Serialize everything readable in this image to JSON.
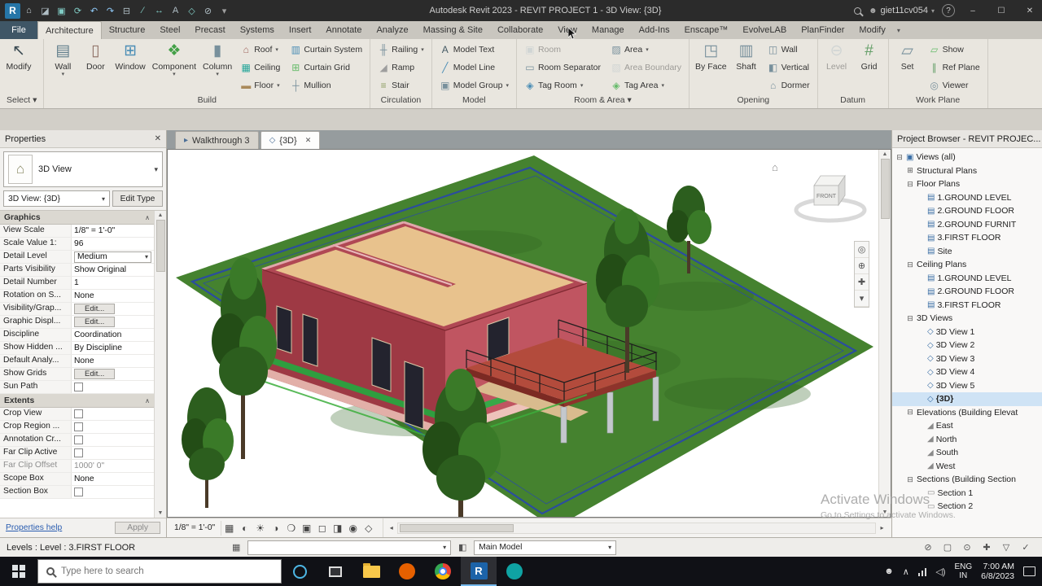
{
  "ui": {
    "caret": "▾",
    "close": "✕",
    "chevron_up": "∧",
    "up": "▲",
    "down": "▼",
    "left": "◂",
    "right": "▸",
    "minus": "⊟",
    "plus": "⊞",
    "home": "⌂",
    "thumb_glyph": "⌂"
  },
  "titlebar": {
    "title": "Autodesk Revit 2023 - REVIT PROJECT 1 - 3D View: {3D}",
    "user": "giet11cv054",
    "help_label": "?",
    "person_glyph": "☻",
    "window_controls": {
      "minimize": "–",
      "maximize": "☐",
      "close": "✕"
    },
    "qat_icons": [
      {
        "name": "revit-app-icon",
        "glyph": "R",
        "cls": "rlogo"
      },
      {
        "name": "home-icon",
        "glyph": "⌂",
        "c": "#cfd8dc"
      },
      {
        "name": "open-folder-icon",
        "glyph": "◪",
        "c": "#b0bec5"
      },
      {
        "name": "save-icon",
        "glyph": "▣",
        "c": "#80cbc4"
      },
      {
        "name": "sync-icon",
        "glyph": "⟳",
        "c": "#80cbc4"
      },
      {
        "name": "undo-icon",
        "glyph": "↶",
        "c": "#90caf9"
      },
      {
        "name": "redo-icon",
        "glyph": "↷",
        "c": "#90caf9"
      },
      {
        "name": "print-icon",
        "glyph": "⊟",
        "c": "#b0bec5"
      },
      {
        "name": "measure-icon",
        "glyph": "∕",
        "c": "#80cbc4"
      },
      {
        "name": "dimension-icon",
        "glyph": "↔",
        "c": "#80cbc4"
      },
      {
        "name": "text-icon",
        "glyph": "A",
        "c": "#b0bec5"
      },
      {
        "name": "3d-view-icon",
        "glyph": "◇",
        "c": "#80cbc4"
      },
      {
        "name": "section-icon",
        "glyph": "⊘",
        "c": "#b0bec5"
      },
      {
        "name": "qat-caret-icon",
        "glyph": "▾",
        "c": "#9e9e9e"
      }
    ]
  },
  "ribbon": {
    "file_tab": "File",
    "tabs_caret": "▾",
    "tabs": [
      {
        "label": "Architecture",
        "active": true
      },
      {
        "label": "Structure"
      },
      {
        "label": "Steel"
      },
      {
        "label": "Precast"
      },
      {
        "label": "Systems"
      },
      {
        "label": "Insert"
      },
      {
        "label": "Annotate"
      },
      {
        "label": "Analyze"
      },
      {
        "label": "Massing & Site"
      },
      {
        "label": "Collaborate"
      },
      {
        "label": "View"
      },
      {
        "label": "Manage"
      },
      {
        "label": "Add-Ins"
      },
      {
        "label": "Enscape™"
      },
      {
        "label": "EvolveLAB"
      },
      {
        "label": "PlanFinder"
      },
      {
        "label": "Modify"
      }
    ],
    "icon_map": {
      "modify-cursor": {
        "g": "↖",
        "c": "#37474f"
      },
      "wall": {
        "g": "▤",
        "c": "#607d8b"
      },
      "door": {
        "g": "▯",
        "c": "#8d6e63"
      },
      "window": {
        "g": "⊞",
        "c": "#4a8db5"
      },
      "component": {
        "g": "❖",
        "c": "#43a047"
      },
      "column": {
        "g": "▮",
        "c": "#78909c"
      },
      "roof": {
        "g": "⌂",
        "c": "#a1665e"
      },
      "ceiling": {
        "g": "▦",
        "c": "#26a69a"
      },
      "floor": {
        "g": "▬",
        "c": "#a98a5b"
      },
      "curtain-system": {
        "g": "▥",
        "c": "#4a8db5"
      },
      "curtain-grid": {
        "g": "⊞",
        "c": "#66bb6a"
      },
      "mullion": {
        "g": "┼",
        "c": "#78909c"
      },
      "railing": {
        "g": "╫",
        "c": "#78909c"
      },
      "ramp": {
        "g": "◢",
        "c": "#9e9e9e"
      },
      "stair": {
        "g": "≡",
        "c": "#8d9e63"
      },
      "model-text": {
        "g": "A",
        "c": "#455a64"
      },
      "model-line": {
        "g": "╱",
        "c": "#4a8db5"
      },
      "model-group": {
        "g": "▣",
        "c": "#78909c"
      },
      "room": {
        "g": "▣",
        "c": "#b0bec5"
      },
      "room-separator": {
        "g": "▭",
        "c": "#78909c"
      },
      "tag-room": {
        "g": "◈",
        "c": "#4a8db5"
      },
      "area": {
        "g": "▨",
        "c": "#78909c"
      },
      "area-boundary": {
        "g": "▧",
        "c": "#b0bec5"
      },
      "tag-area": {
        "g": "◈",
        "c": "#66bb6a"
      },
      "by-face": {
        "g": "◳",
        "c": "#78909c"
      },
      "shaft": {
        "g": "▥",
        "c": "#78909c"
      },
      "wall-opening": {
        "g": "◫",
        "c": "#78909c"
      },
      "vertical-opening": {
        "g": "◧",
        "c": "#78909c"
      },
      "dormer": {
        "g": "⌂",
        "c": "#78909c"
      },
      "level": {
        "g": "⊖",
        "c": "#b0bec5"
      },
      "grid": {
        "g": "#",
        "c": "#66a06a"
      },
      "set-plane": {
        "g": "▱",
        "c": "#78909c"
      },
      "show-plane": {
        "g": "▱",
        "c": "#66bb6a"
      },
      "ref-plane": {
        "g": "∥",
        "c": "#66a06a"
      },
      "viewer": {
        "g": "◎",
        "c": "#78909c"
      }
    },
    "panels": [
      {
        "name": "Select ▾",
        "big": [
          {
            "label": "Modify",
            "icon": "modify-cursor"
          }
        ]
      },
      {
        "name": "Build",
        "big": [
          {
            "label": "Wall",
            "icon": "wall",
            "arrow": true
          },
          {
            "label": "Door",
            "icon": "door"
          },
          {
            "label": "Window",
            "icon": "window"
          },
          {
            "label": "Component",
            "icon": "component",
            "arrow": true
          },
          {
            "label": "Column",
            "icon": "column",
            "arrow": true
          }
        ],
        "cols": [
          [
            {
              "label": "Roof",
              "icon": "roof",
              "arrow": true
            },
            {
              "label": "Ceiling",
              "icon": "ceiling"
            },
            {
              "label": "Floor",
              "icon": "floor",
              "arrow": true
            }
          ],
          [
            {
              "label": "Curtain System",
              "icon": "curtain-system"
            },
            {
              "label": "Curtain Grid",
              "icon": "curtain-grid"
            },
            {
              "label": "Mullion",
              "icon": "mullion"
            }
          ]
        ]
      },
      {
        "name": "Circulation",
        "cols": [
          [
            {
              "label": "Railing",
              "icon": "railing",
              "arrow": true
            },
            {
              "label": "Ramp",
              "icon": "ramp"
            },
            {
              "label": "Stair",
              "icon": "stair"
            }
          ]
        ]
      },
      {
        "name": "Model",
        "cols": [
          [
            {
              "label": "Model Text",
              "icon": "model-text"
            },
            {
              "label": "Model Line",
              "icon": "model-line"
            },
            {
              "label": "Model Group",
              "icon": "model-group",
              "arrow": true
            }
          ]
        ]
      },
      {
        "name": "Room & Area ▾",
        "cols": [
          [
            {
              "label": "Room",
              "icon": "room",
              "disabled": true
            },
            {
              "label": "Room Separator",
              "icon": "room-separator"
            },
            {
              "label": "Tag Room",
              "icon": "tag-room",
              "arrow": true
            }
          ],
          [
            {
              "label": "Area",
              "icon": "area",
              "arrow": true
            },
            {
              "label": "Area Boundary",
              "icon": "area-boundary",
              "disabled": true
            },
            {
              "label": "Tag Area",
              "icon": "tag-area",
              "arrow": true
            }
          ]
        ]
      },
      {
        "name": "Opening",
        "big": [
          {
            "label": "By Face",
            "icon": "by-face"
          },
          {
            "label": "Shaft",
            "icon": "shaft"
          }
        ],
        "cols": [
          [
            {
              "label": "Wall",
              "icon": "wall-opening"
            },
            {
              "label": "Vertical",
              "icon": "vertical-opening"
            },
            {
              "label": "Dormer",
              "icon": "dormer"
            }
          ]
        ]
      },
      {
        "name": "Datum",
        "big": [
          {
            "label": "Level",
            "icon": "level",
            "disabled": true
          },
          {
            "label": "Grid",
            "icon": "grid"
          }
        ]
      },
      {
        "name": "Work Plane",
        "big": [
          {
            "label": "Set",
            "icon": "set-plane"
          }
        ],
        "cols": [
          [
            {
              "label": "Show",
              "icon": "show-plane"
            },
            {
              "label": "Ref Plane",
              "icon": "ref-plane"
            },
            {
              "label": "Viewer",
              "icon": "viewer"
            }
          ]
        ]
      }
    ]
  },
  "properties": {
    "panel_title": "Properties",
    "type_label": "3D View",
    "instance_combo": "3D View: {3D}",
    "edit_type_label": "Edit Type",
    "graphics_header": "Graphics",
    "extents_header": "Extents",
    "graphics_rows": [
      {
        "label": "View Scale",
        "value": "1/8\" = 1'-0\""
      },
      {
        "label": "Scale Value    1:",
        "value": "96"
      },
      {
        "label": "Detail Level",
        "value": "Medium",
        "type": "select"
      },
      {
        "label": "Parts Visibility",
        "value": "Show Original"
      },
      {
        "label": "Detail Number",
        "value": "1"
      },
      {
        "label": "Rotation on S...",
        "value": "None"
      },
      {
        "label": "Visibility/Grap...",
        "value": "Edit...",
        "type": "button"
      },
      {
        "label": "Graphic Displ...",
        "value": "Edit...",
        "type": "button"
      },
      {
        "label": "Discipline",
        "value": "Coordination"
      },
      {
        "label": "Show Hidden ...",
        "value": "By Discipline"
      },
      {
        "label": "Default Analy...",
        "value": "None"
      },
      {
        "label": "Show Grids",
        "value": "Edit...",
        "type": "button"
      },
      {
        "label": "Sun Path",
        "type": "check"
      }
    ],
    "extents_rows": [
      {
        "label": "Crop View",
        "type": "check"
      },
      {
        "label": "Crop Region ...",
        "type": "check"
      },
      {
        "label": "Annotation Cr...",
        "type": "check"
      },
      {
        "label": "Far Clip Active",
        "type": "check"
      },
      {
        "label": "Far Clip Offset",
        "value": "1000' 0\"",
        "dim": true
      },
      {
        "label": "Scope Box",
        "value": "None"
      },
      {
        "label": "Section Box",
        "type": "check"
      }
    ],
    "help_link": "Properties help",
    "apply_label": "Apply"
  },
  "view_tabs": [
    {
      "label": "Walkthrough 3",
      "icon": "walkthrough-tab-icon",
      "glyph": "▸"
    },
    {
      "label": "{3D}",
      "icon": "3d-view-tab-icon",
      "glyph": "◇",
      "active": true
    }
  ],
  "canvas": {
    "viewcube_front": "FRONT"
  },
  "navbar_icons": [
    {
      "name": "navigation-wheel-icon",
      "glyph": "◎"
    },
    {
      "name": "zoom-icon",
      "glyph": "⊕"
    },
    {
      "name": "pan-icon",
      "glyph": "✚"
    },
    {
      "name": "navbar-caret-icon",
      "glyph": "▾"
    }
  ],
  "viewbar": {
    "scale": "1/8\" = 1'-0\"",
    "icons": [
      {
        "name": "detail-level-icon",
        "glyph": "▦"
      },
      {
        "name": "visual-style-icon",
        "glyph": "◐"
      },
      {
        "name": "sun-path-icon",
        "glyph": "☀"
      },
      {
        "name": "shadows-icon",
        "glyph": "◑"
      },
      {
        "name": "render-icon",
        "glyph": "❍"
      },
      {
        "name": "crop-view-icon",
        "glyph": "▣"
      },
      {
        "name": "crop-region-icon",
        "glyph": "◻"
      },
      {
        "name": "hide-isolate-icon",
        "glyph": "◨"
      },
      {
        "name": "reveal-hidden-icon",
        "glyph": "◉"
      },
      {
        "name": "view-properties-icon",
        "glyph": "◇"
      }
    ]
  },
  "project_browser": {
    "panel_title": "Project Browser - REVIT PROJEC...",
    "icon_map": {
      "views-root": "▣",
      "plan": "▤",
      "view3d": "◇",
      "elevation": "◢",
      "section": "▭"
    },
    "tree": [
      {
        "t": "Views (all)",
        "d": 0,
        "e": 1,
        "icon": "views-root"
      },
      {
        "t": "Structural Plans",
        "d": 1,
        "e": 0
      },
      {
        "t": "Floor Plans",
        "d": 1,
        "e": 1
      },
      {
        "t": "1.GROUND LEVEL",
        "d": 2,
        "icon": "plan"
      },
      {
        "t": "2.GROUND FLOOR",
        "d": 2,
        "icon": "plan"
      },
      {
        "t": "2.GROUND FURNIT",
        "d": 2,
        "icon": "plan"
      },
      {
        "t": "3.FIRST FLOOR",
        "d": 2,
        "icon": "plan"
      },
      {
        "t": "Site",
        "d": 2,
        "icon": "plan"
      },
      {
        "t": "Ceiling Plans",
        "d": 1,
        "e": 1
      },
      {
        "t": "1.GROUND LEVEL",
        "d": 2,
        "icon": "plan"
      },
      {
        "t": "2.GROUND FLOOR",
        "d": 2,
        "icon": "plan"
      },
      {
        "t": "3.FIRST FLOOR",
        "d": 2,
        "icon": "plan"
      },
      {
        "t": "3D Views",
        "d": 1,
        "e": 1
      },
      {
        "t": "3D View 1",
        "d": 2,
        "icon": "view3d"
      },
      {
        "t": "3D View 2",
        "d": 2,
        "icon": "view3d"
      },
      {
        "t": "3D View 3",
        "d": 2,
        "icon": "view3d"
      },
      {
        "t": "3D View 4",
        "d": 2,
        "icon": "view3d"
      },
      {
        "t": "3D View 5",
        "d": 2,
        "icon": "view3d"
      },
      {
        "t": "{3D}",
        "d": 2,
        "icon": "view3d",
        "sel": true
      },
      {
        "t": "Elevations (Building Elevat",
        "d": 1,
        "e": 1
      },
      {
        "t": "East",
        "d": 2,
        "icon": "elevation"
      },
      {
        "t": "North",
        "d": 2,
        "icon": "elevation"
      },
      {
        "t": "South",
        "d": 2,
        "icon": "elevation"
      },
      {
        "t": "West",
        "d": 2,
        "icon": "elevation"
      },
      {
        "t": "Sections (Building Section",
        "d": 1,
        "e": 1
      },
      {
        "t": "Section 1",
        "d": 2,
        "icon": "section"
      },
      {
        "t": "Section 2",
        "d": 2,
        "icon": "section"
      }
    ]
  },
  "statusbar": {
    "left_text": "Levels : Level : 3.FIRST FLOOR",
    "worksets_icon": "▦",
    "design_options_icon": "◧",
    "workset_value": "",
    "design_option_value": "Main Model",
    "right_icons": [
      {
        "name": "worksharing-display-icon",
        "glyph": "⊘"
      },
      {
        "name": "design-options-toggle-icon",
        "glyph": "▢"
      },
      {
        "name": "exclude-options-icon",
        "glyph": "⊙"
      },
      {
        "name": "press-drag-icon",
        "glyph": "✚"
      },
      {
        "name": "filter-icon",
        "glyph": "▽"
      },
      {
        "name": "editable-only-icon",
        "glyph": "✓"
      }
    ]
  },
  "watermark": {
    "line1": "Activate Windows",
    "line2": "Go to Settings to activate Windows."
  },
  "taskbar": {
    "search_placeholder": "Type here to search",
    "apps": [
      {
        "name": "cortana-icon",
        "style": "ring"
      },
      {
        "name": "task-view-icon",
        "style": "taskview"
      },
      {
        "name": "file-explorer-icon",
        "style": "folder"
      },
      {
        "name": "firefox-icon",
        "style": "circle",
        "color": "#e66000"
      },
      {
        "name": "chrome-icon",
        "style": "chrome"
      },
      {
        "name": "revit-taskbar-icon",
        "style": "tile",
        "color": "#1c63a8",
        "letter": "R",
        "active": true
      },
      {
        "name": "media-app-icon",
        "style": "circle",
        "color": "#0fa3a3"
      }
    ],
    "tray": {
      "caret": "∧",
      "person": "☻",
      "volume": "◁)",
      "lang_top": "ENG",
      "lang_bottom": "IN",
      "time": "7:00 AM",
      "date": "6/8/2023"
    }
  }
}
